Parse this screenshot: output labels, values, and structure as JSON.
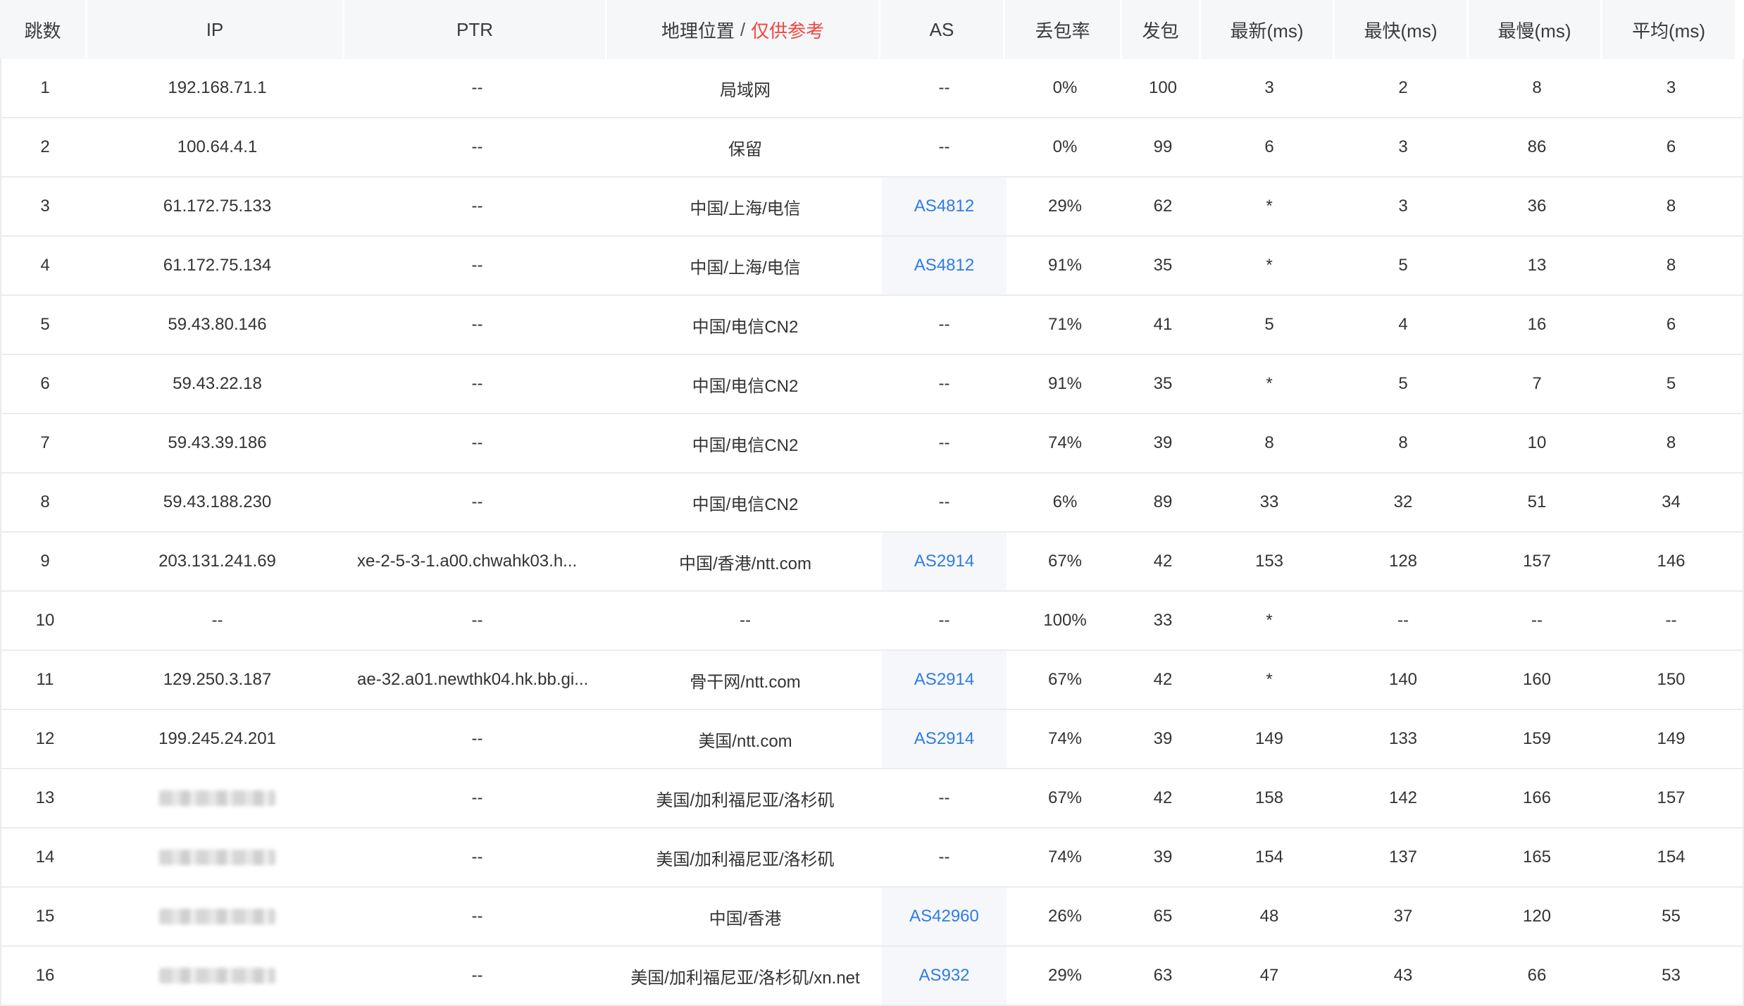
{
  "header": {
    "hop": "跳数",
    "ip": "IP",
    "ptr": "PTR",
    "geo": "地理位置",
    "geo_sep": "/",
    "geo_ref": "仅供参考",
    "as": "AS",
    "loss": "丢包率",
    "sent": "发包",
    "last": "最新(ms)",
    "best": "最快(ms)",
    "worst": "最慢(ms)",
    "avg": "平均(ms)"
  },
  "colors": {
    "as_link": "#2f7be8",
    "reference_red": "#f2453d",
    "header_bg": "#f6f7f9",
    "as_cell_bg": "#f5f7fa"
  },
  "rows": [
    {
      "hop": "1",
      "ip": "192.168.71.1",
      "ip_blurred": false,
      "ptr": "--",
      "geo": "局域网",
      "as": "--",
      "as_link": false,
      "loss": "0%",
      "sent": "100",
      "last": "3",
      "best": "2",
      "worst": "8",
      "avg": "3"
    },
    {
      "hop": "2",
      "ip": "100.64.4.1",
      "ip_blurred": false,
      "ptr": "--",
      "geo": "保留",
      "as": "--",
      "as_link": false,
      "loss": "0%",
      "sent": "99",
      "last": "6",
      "best": "3",
      "worst": "86",
      "avg": "6"
    },
    {
      "hop": "3",
      "ip": "61.172.75.133",
      "ip_blurred": false,
      "ptr": "--",
      "geo": "中国/上海/电信",
      "as": "AS4812",
      "as_link": true,
      "loss": "29%",
      "sent": "62",
      "last": "*",
      "best": "3",
      "worst": "36",
      "avg": "8"
    },
    {
      "hop": "4",
      "ip": "61.172.75.134",
      "ip_blurred": false,
      "ptr": "--",
      "geo": "中国/上海/电信",
      "as": "AS4812",
      "as_link": true,
      "loss": "91%",
      "sent": "35",
      "last": "*",
      "best": "5",
      "worst": "13",
      "avg": "8"
    },
    {
      "hop": "5",
      "ip": "59.43.80.146",
      "ip_blurred": false,
      "ptr": "--",
      "geo": "中国/电信CN2",
      "as": "--",
      "as_link": false,
      "loss": "71%",
      "sent": "41",
      "last": "5",
      "best": "4",
      "worst": "16",
      "avg": "6"
    },
    {
      "hop": "6",
      "ip": "59.43.22.18",
      "ip_blurred": false,
      "ptr": "--",
      "geo": "中国/电信CN2",
      "as": "--",
      "as_link": false,
      "loss": "91%",
      "sent": "35",
      "last": "*",
      "best": "5",
      "worst": "7",
      "avg": "5"
    },
    {
      "hop": "7",
      "ip": "59.43.39.186",
      "ip_blurred": false,
      "ptr": "--",
      "geo": "中国/电信CN2",
      "as": "--",
      "as_link": false,
      "loss": "74%",
      "sent": "39",
      "last": "8",
      "best": "8",
      "worst": "10",
      "avg": "8"
    },
    {
      "hop": "8",
      "ip": "59.43.188.230",
      "ip_blurred": false,
      "ptr": "--",
      "geo": "中国/电信CN2",
      "as": "--",
      "as_link": false,
      "loss": "6%",
      "sent": "89",
      "last": "33",
      "best": "32",
      "worst": "51",
      "avg": "34"
    },
    {
      "hop": "9",
      "ip": "203.131.241.69",
      "ip_blurred": false,
      "ptr": "xe-2-5-3-1.a00.chwahk03.h...",
      "geo": "中国/香港/ntt.com",
      "as": "AS2914",
      "as_link": true,
      "loss": "67%",
      "sent": "42",
      "last": "153",
      "best": "128",
      "worst": "157",
      "avg": "146"
    },
    {
      "hop": "10",
      "ip": "--",
      "ip_blurred": false,
      "ptr": "--",
      "geo": "--",
      "as": "--",
      "as_link": false,
      "loss": "100%",
      "sent": "33",
      "last": "*",
      "best": "--",
      "worst": "--",
      "avg": "--"
    },
    {
      "hop": "11",
      "ip": "129.250.3.187",
      "ip_blurred": false,
      "ptr": "ae-32.a01.newthk04.hk.bb.gi...",
      "geo": "骨干网/ntt.com",
      "as": "AS2914",
      "as_link": true,
      "loss": "67%",
      "sent": "42",
      "last": "*",
      "best": "140",
      "worst": "160",
      "avg": "150"
    },
    {
      "hop": "12",
      "ip": "199.245.24.201",
      "ip_blurred": false,
      "ptr": "--",
      "geo": "美国/ntt.com",
      "as": "AS2914",
      "as_link": true,
      "loss": "74%",
      "sent": "39",
      "last": "149",
      "best": "133",
      "worst": "159",
      "avg": "149"
    },
    {
      "hop": "13",
      "ip": "",
      "ip_blurred": true,
      "ptr": "--",
      "geo": "美国/加利福尼亚/洛杉矶",
      "as": "--",
      "as_link": false,
      "loss": "67%",
      "sent": "42",
      "last": "158",
      "best": "142",
      "worst": "166",
      "avg": "157"
    },
    {
      "hop": "14",
      "ip": "",
      "ip_blurred": true,
      "ptr": "--",
      "geo": "美国/加利福尼亚/洛杉矶",
      "as": "--",
      "as_link": false,
      "loss": "74%",
      "sent": "39",
      "last": "154",
      "best": "137",
      "worst": "165",
      "avg": "154"
    },
    {
      "hop": "15",
      "ip": "",
      "ip_blurred": true,
      "ptr": "--",
      "geo": "中国/香港",
      "as": "AS42960",
      "as_link": true,
      "loss": "26%",
      "sent": "65",
      "last": "48",
      "best": "37",
      "worst": "120",
      "avg": "55"
    },
    {
      "hop": "16",
      "ip": "",
      "ip_blurred": true,
      "ptr": "--",
      "geo": "美国/加利福尼亚/洛杉矶/xn.net",
      "as": "AS932",
      "as_link": true,
      "loss": "29%",
      "sent": "63",
      "last": "47",
      "best": "43",
      "worst": "66",
      "avg": "53"
    }
  ]
}
